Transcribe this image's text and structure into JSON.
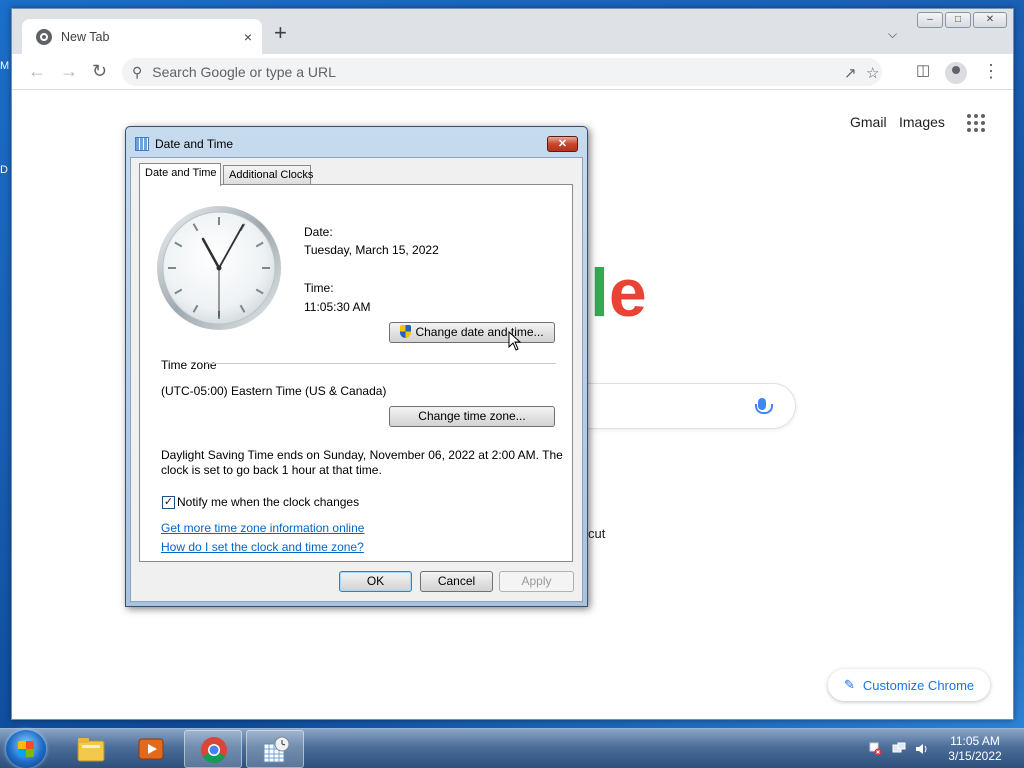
{
  "desktop": {
    "icon_label_1": "M",
    "icon_label_2": "D"
  },
  "browser": {
    "tab_title": "New Tab",
    "tab_close": "×",
    "new_tab": "+",
    "omnibox_placeholder": "Search Google or type a URL",
    "window_controls": {
      "minimize": "–",
      "maximize": "□",
      "close": "✕"
    },
    "header_links": {
      "gmail": "Gmail",
      "images": "Images"
    },
    "logo_fragment": {
      "l": "l",
      "e": "e"
    },
    "shortcut_fragment": "cut",
    "customize_label": "Customize Chrome",
    "colors": {
      "logo_green": "#34a853",
      "logo_red": "#ea4335",
      "accent": "#1a73e8"
    }
  },
  "dialog": {
    "title": "Date and Time",
    "close": "✕",
    "tabs": [
      "Date and Time",
      "Additional Clocks"
    ],
    "date_label": "Date:",
    "date_value": "Tuesday, March 15, 2022",
    "time_label": "Time:",
    "time_value": "11:05:30 AM",
    "change_datetime_button": "Change date and time...",
    "timezone_heading": "Time zone",
    "timezone_value": "(UTC-05:00) Eastern Time (US & Canada)",
    "change_timezone_button": "Change time zone...",
    "dst_line1": "Daylight Saving Time ends on Sunday, November 06, 2022 at 2:00 AM. The",
    "dst_line2": "clock is set to go back 1 hour at that time.",
    "notify_checked": true,
    "notify_label": "Notify me when the clock changes",
    "link_more_info": "Get more time zone information online",
    "link_how_to": "How do I set the clock and time zone?",
    "ok_button": "OK",
    "cancel_button": "Cancel",
    "apply_button": "Apply"
  },
  "taskbar": {
    "clock_time": "11:05 AM",
    "clock_date": "3/15/2022",
    "pinned": [
      "file-explorer-icon",
      "media-player-icon",
      "chrome-icon",
      "date-time-icon"
    ]
  }
}
